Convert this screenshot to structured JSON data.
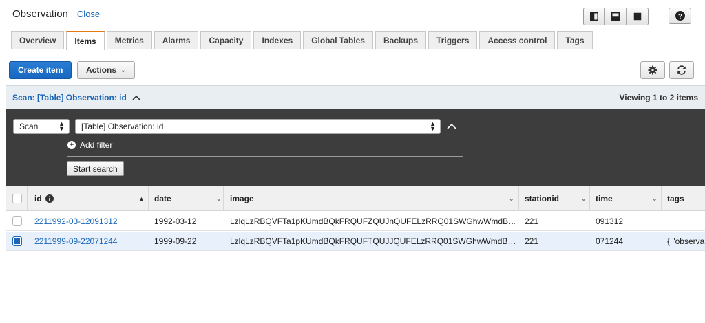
{
  "header": {
    "title": "Observation",
    "close_label": "Close"
  },
  "view_buttons": [
    "split-vertical-icon",
    "split-horizontal-icon",
    "full-view-icon"
  ],
  "help_icon": "question-circle-icon",
  "tabs": [
    {
      "label": "Overview",
      "active": false
    },
    {
      "label": "Items",
      "active": true
    },
    {
      "label": "Metrics",
      "active": false
    },
    {
      "label": "Alarms",
      "active": false
    },
    {
      "label": "Capacity",
      "active": false
    },
    {
      "label": "Indexes",
      "active": false
    },
    {
      "label": "Global Tables",
      "active": false
    },
    {
      "label": "Backups",
      "active": false
    },
    {
      "label": "Triggers",
      "active": false
    },
    {
      "label": "Access control",
      "active": false
    },
    {
      "label": "Tags",
      "active": false
    }
  ],
  "toolbar": {
    "create_item_label": "Create item",
    "actions_label": "Actions",
    "settings_icon": "gear-icon",
    "refresh_icon": "refresh-icon"
  },
  "scan_band": {
    "label": "Scan: [Table] Observation: id",
    "viewing": "Viewing 1 to 2 items"
  },
  "query": {
    "mode": "Scan",
    "target": "[Table] Observation: id",
    "add_filter_label": "Add filter",
    "start_search_label": "Start search"
  },
  "table": {
    "columns": [
      "id",
      "date",
      "image",
      "stationid",
      "time",
      "tags"
    ],
    "rows": [
      {
        "checked": false,
        "id": "2211992-03-12091312",
        "date": "1992-03-12",
        "image": "LzlqLzRBQVFTa1pKUmdBQkFRQUFZQUJnQUFELzRRQ01SWGhwWmdB…",
        "stationid": "221",
        "time": "091312",
        "tags": ""
      },
      {
        "checked": true,
        "id": "2211999-09-22071244",
        "date": "1999-09-22",
        "image": "LzlqLzRBQVFTa1pKUmdBQkFRQUFTQUJJQUFELzRRQ01SWGhwWmdB…",
        "stationid": "221",
        "time": "071244",
        "tags": "{ \"observa"
      }
    ]
  },
  "colors": {
    "accent": "#1a66b8",
    "active_tab": "#e47911",
    "panel": "#3d3d3d"
  }
}
